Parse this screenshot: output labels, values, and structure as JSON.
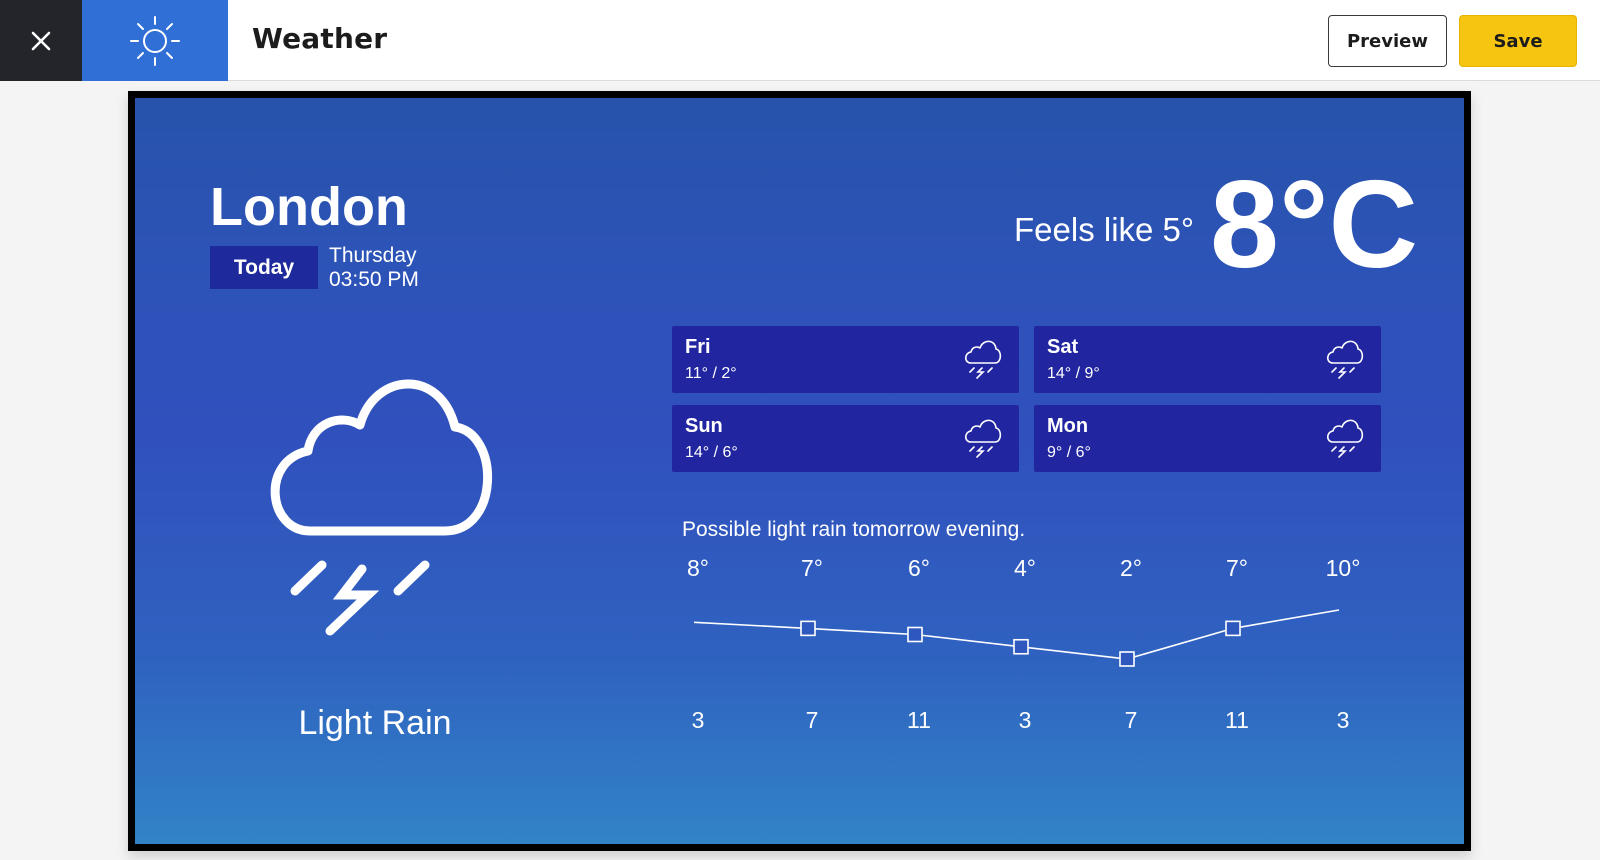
{
  "app": {
    "title": "Weather",
    "preview_label": "Preview",
    "save_label": "Save",
    "close_icon": "close-icon",
    "app_icon": "sun-icon"
  },
  "weather": {
    "city": "London",
    "today_label": "Today",
    "day": "Thursday",
    "time": "03:50 PM",
    "feels_like": "Feels like 5°",
    "temperature": "8°C",
    "condition": "Light Rain",
    "condition_icon": "cloud-lightning-icon",
    "forecast": [
      {
        "day": "Fri",
        "range": "11°  /  2°",
        "icon": "cloud-lightning-icon"
      },
      {
        "day": "Sat",
        "range": "14°  /  9°",
        "icon": "cloud-lightning-icon"
      },
      {
        "day": "Sun",
        "range": "14°  /  6°",
        "icon": "cloud-lightning-icon"
      },
      {
        "day": "Mon",
        "range": "9°  /  6°",
        "icon": "cloud-lightning-icon"
      }
    ],
    "note": "Possible light rain tomorrow evening."
  },
  "chart_data": {
    "type": "line",
    "title": "",
    "xlabel": "",
    "ylabel": "",
    "top_labels": [
      "8°",
      "7°",
      "6°",
      "4°",
      "2°",
      "7°",
      "10°"
    ],
    "bottom_labels": [
      "3",
      "7",
      "11",
      "3",
      "7",
      "11",
      "3"
    ],
    "values": [
      8,
      7,
      6,
      4,
      2,
      7,
      10
    ],
    "markers": [
      false,
      true,
      true,
      true,
      true,
      true,
      false
    ]
  },
  "colors": {
    "accent_blue": "#2f6fd6",
    "save_yellow": "#f6c511",
    "card_bg": "#2126a0",
    "dark": "#23252b"
  }
}
